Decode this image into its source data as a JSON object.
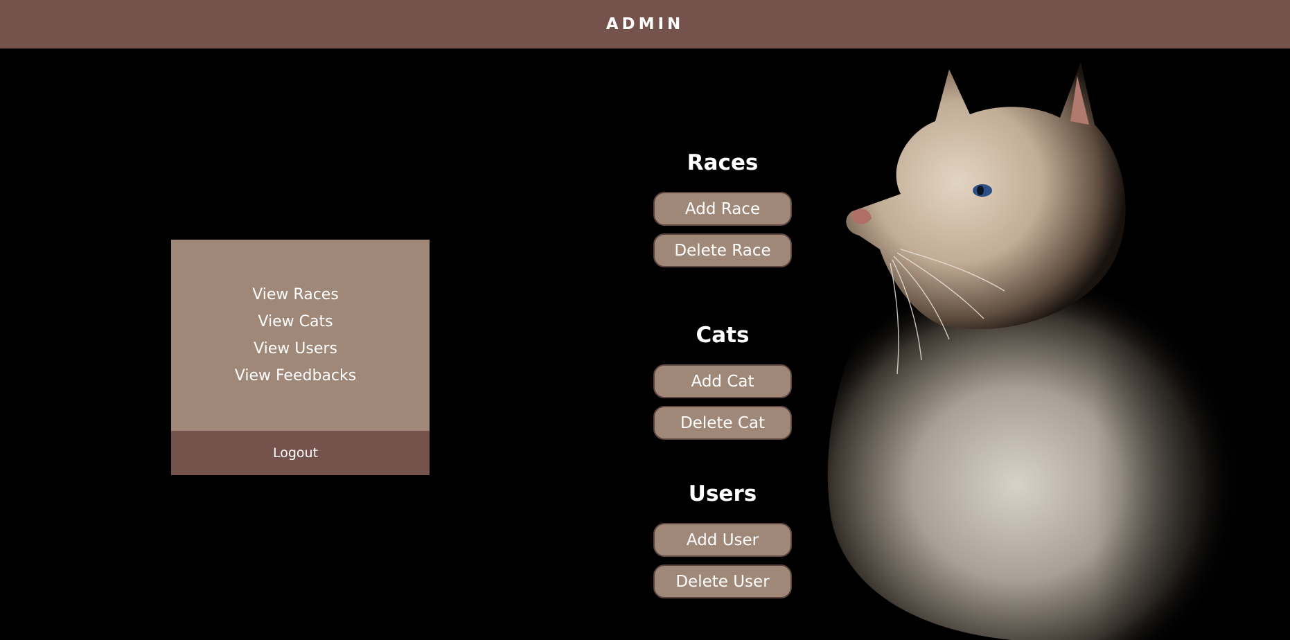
{
  "header": {
    "title": "ADMIN"
  },
  "nav": {
    "links": [
      {
        "label": "View Races"
      },
      {
        "label": "View Cats"
      },
      {
        "label": "View Users"
      },
      {
        "label": "View Feedbacks"
      }
    ],
    "logout_label": "Logout"
  },
  "sections": {
    "races": {
      "title": "Races",
      "add_label": "Add Race",
      "delete_label": "Delete Race"
    },
    "cats": {
      "title": "Cats",
      "add_label": "Add Cat",
      "delete_label": "Delete Cat"
    },
    "users": {
      "title": "Users",
      "add_label": "Add User",
      "delete_label": "Delete User"
    }
  },
  "colors": {
    "header_bg": "#76524c",
    "panel_bg": "#a08878",
    "page_bg": "#000000",
    "text": "#ffffff"
  },
  "images": {
    "hero": "cat-photo"
  }
}
